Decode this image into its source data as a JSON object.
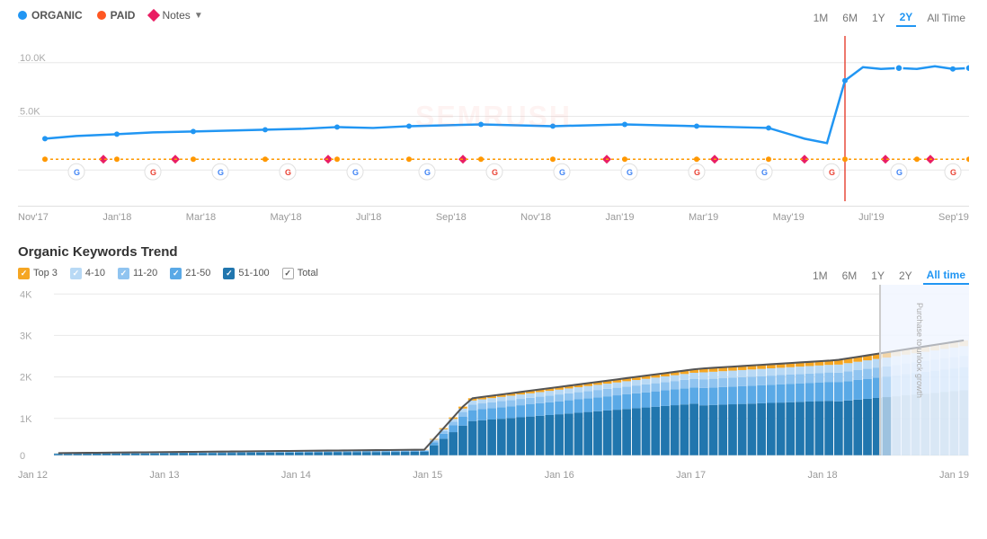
{
  "topChart": {
    "legend": {
      "organic": "ORGANIC",
      "paid": "PAID",
      "notes": "Notes"
    },
    "timeFilters": [
      "1M",
      "6M",
      "1Y",
      "2Y",
      "All Time"
    ],
    "activeFilter": "2Y",
    "yLabels": [
      "10.0K",
      "5.0K"
    ],
    "xLabels": [
      "Nov'17",
      "Jan'18",
      "Mar'18",
      "May'18",
      "Jul'18",
      "Sep'18",
      "Nov'18",
      "Jan'19",
      "Mar'19",
      "May'19",
      "Jul'19",
      "Sep'19"
    ]
  },
  "bottomChart": {
    "title": "Organic Keywords Trend",
    "legend": [
      {
        "label": "Top 3",
        "key": "top3"
      },
      {
        "label": "4-10",
        "key": "r4_10"
      },
      {
        "label": "11-20",
        "key": "r11_20"
      },
      {
        "label": "21-50",
        "key": "r21_50"
      },
      {
        "label": "51-100",
        "key": "r51_100"
      },
      {
        "label": "Total",
        "key": "total"
      }
    ],
    "timeFilters": [
      "1M",
      "6M",
      "1Y",
      "2Y",
      "All time"
    ],
    "activeFilter": "All time",
    "yLabels": [
      "4K",
      "3K",
      "2K",
      "1K",
      "0"
    ],
    "xLabels": [
      "Jan 12",
      "Jan 13",
      "Jan 14",
      "Jan 15",
      "Jan 16",
      "Jan 17",
      "Jan 18",
      "Jan 19"
    ],
    "purchaseLabel": "Purchase to unlock growth"
  }
}
